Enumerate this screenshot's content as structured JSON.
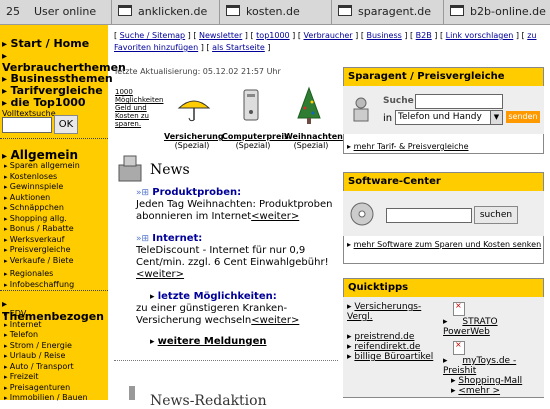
{
  "topbar": {
    "counter": "25",
    "status": "User online",
    "tabs": [
      "anklicken.de",
      "kosten.de",
      "sparagent.de",
      "b2b-online.de"
    ]
  },
  "sidebar": {
    "categories": [
      "Start / Home",
      "Verbraucherthemen",
      "Businessthemen",
      "Tarifvergleiche",
      "die Top1000"
    ],
    "search": {
      "label": "Volltextsuche",
      "button": "OK",
      "value": ""
    },
    "allgemein": {
      "title": "Allgemein",
      "items": [
        "Sparen allgemein",
        "Kostenloses",
        "Gewinnspiele",
        "Auktionen",
        "Schnäppchen",
        "Shopping allg.",
        "Bonus / Rabatte",
        "Werksverkauf",
        "Preisvergleiche",
        "Verkaufe / Biete",
        "Regionales",
        "Infobeschaffung"
      ]
    },
    "themen": {
      "title": "Themenbezogen",
      "items": [
        "EDV",
        "Internet",
        "Telefon",
        "Strom / Energie",
        "Urlaub / Reise",
        "Auto / Transport",
        "Freizeit",
        "Preisagenturen",
        "Immobilien / Bauen"
      ]
    }
  },
  "nav": {
    "links": [
      "Suche / Sitemap",
      "Newsletter",
      "top1000",
      "Verbraucher",
      "Business",
      "B2B",
      "Link vorschlagen",
      "zu Favoriten hinzufügen",
      "als Startseite"
    ]
  },
  "update": "letzte Aktualisierung: 05.12.02 21:57 Uhr",
  "promo": "1000 Möglichkeiten Geld und Kosten zu sparen.",
  "spezial": [
    {
      "title": "Versicherung",
      "sub": "(Spezial)"
    },
    {
      "title": "Computerpreis",
      "sub": "(Spezial)"
    },
    {
      "title": "Weihnachten",
      "sub": "(Spezial)"
    }
  ],
  "news": {
    "heading": "News",
    "items": [
      {
        "title": "Produktproben:",
        "text": "Jeden Tag Weihnachten: Produktproben abonnieren im Internet",
        "more": "<weiter>"
      },
      {
        "title": "Internet:",
        "text": "TeleDiscount - Internet für nur 0,9 Cent/min. zzgl. 6 Cent Einwahlgebühr!",
        "more": "<weiter>"
      },
      {
        "title": "letzte Möglichkeiten:",
        "text": "zu einer günstigeren Kranken-Versicherung wechseln",
        "more": "<weiter>"
      }
    ],
    "more_news": "weitere Meldungen"
  },
  "sparagent": {
    "header": "Sparagent / Preisvergleiche",
    "search_label": "Suche",
    "in_label": "in",
    "select_value": "Telefon und Handy",
    "send_button": "senden",
    "more_link": "mehr Tarif- & Preisvergleiche"
  },
  "software": {
    "header": "Software-Center",
    "search_button": "suchen",
    "more_link": "mehr Software zum Sparen und Kosten senken"
  },
  "quicktipps": {
    "header": "Quicktipps",
    "left": [
      "Versicherungs-Vergl.",
      "preistrend.de",
      "reifendirekt.de",
      "billige Büroartikel"
    ],
    "right": [
      "STRATO PowerWeb",
      "myToys.de - Preishit",
      "Shopping-Mall",
      "<mehr >"
    ]
  }
}
